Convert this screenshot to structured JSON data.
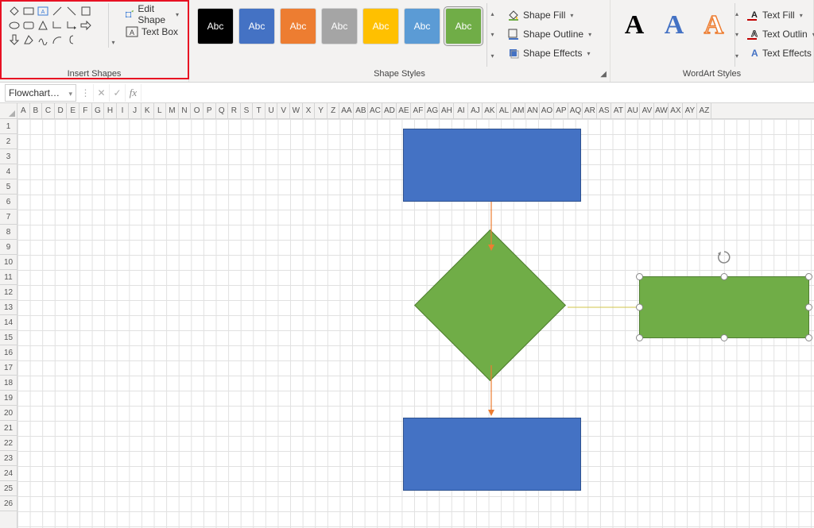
{
  "ribbon": {
    "insert_shapes": {
      "label": "Insert Shapes",
      "edit_shape": "Edit Shape",
      "text_box": "Text Box"
    },
    "shape_styles": {
      "label": "Shape Styles",
      "swatch_text": "Abc",
      "swatches": [
        {
          "bg": "#000000"
        },
        {
          "bg": "#4472c4"
        },
        {
          "bg": "#ed7d31"
        },
        {
          "bg": "#a5a5a5"
        },
        {
          "bg": "#ffc000"
        },
        {
          "bg": "#5b9bd5"
        },
        {
          "bg": "#70ad47"
        }
      ],
      "selected_index": 6,
      "shape_fill": "Shape Fill",
      "shape_outline": "Shape Outline",
      "shape_effects": "Shape Effects"
    },
    "wordart": {
      "label": "WordArt Styles",
      "sample": "A",
      "text_fill": "Text Fill",
      "text_outline": "Text Outlin",
      "text_effects": "Text Effects"
    }
  },
  "formula_bar": {
    "name_box": "Flowchart…",
    "fx": "fx"
  },
  "grid": {
    "cols": [
      "A",
      "B",
      "C",
      "D",
      "E",
      "F",
      "G",
      "H",
      "I",
      "J",
      "K",
      "L",
      "M",
      "N",
      "O",
      "P",
      "Q",
      "R",
      "S",
      "T",
      "U",
      "V",
      "W",
      "X",
      "Y",
      "Z",
      "AA",
      "AB",
      "AC",
      "AD",
      "AE",
      "AF",
      "AG",
      "AH",
      "AI",
      "AJ",
      "AK",
      "AL",
      "AM",
      "AN",
      "AO",
      "AP",
      "AQ",
      "AR",
      "AS",
      "AT",
      "AU",
      "AV",
      "AW",
      "AX",
      "AY",
      "AZ"
    ],
    "row_count": 26
  }
}
